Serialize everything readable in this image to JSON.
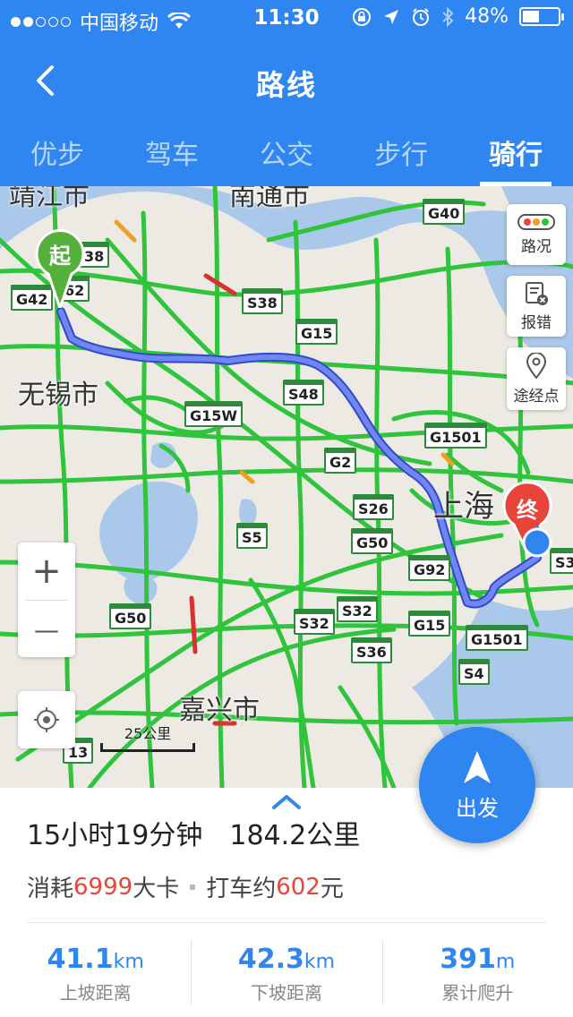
{
  "status_bar": {
    "carrier": "中国移动",
    "time": "11:30",
    "battery": "48%",
    "battery_level": 0.48
  },
  "nav": {
    "title": "路线"
  },
  "tabs": [
    {
      "label": "优步"
    },
    {
      "label": "驾车"
    },
    {
      "label": "公交"
    },
    {
      "label": "步行"
    },
    {
      "label": "骑行",
      "active": true
    }
  ],
  "map": {
    "cities": [
      "靖江市",
      "南通市",
      "无锡市",
      "上海",
      "嘉兴市"
    ],
    "highways": [
      "G40",
      "G42",
      "S38",
      "G15",
      "S48",
      "G15W",
      "G1501",
      "G2",
      "S26",
      "G50",
      "S5",
      "G92",
      "G50",
      "S32",
      "S32",
      "G15",
      "S36",
      "G1501",
      "S4",
      "S3",
      "38",
      "62",
      "13"
    ],
    "start_label": "起",
    "end_label": "终",
    "side_buttons": {
      "traffic": "路况",
      "report": "报错",
      "waypoint": "途经点"
    },
    "zoom_in": "+",
    "zoom_out": "—",
    "scale": "25公里"
  },
  "go_button": {
    "label": "出发"
  },
  "route": {
    "duration": "15小时19分钟",
    "distance": "184.2公里",
    "calories_prefix": "消耗",
    "calories_value": "6999",
    "calories_suffix": "大卡",
    "taxi_prefix": "打车约",
    "taxi_value": "602",
    "taxi_suffix": "元"
  },
  "stats": [
    {
      "value": "41.1",
      "unit": "km",
      "label": "上坡距离"
    },
    {
      "value": "42.3",
      "unit": "km",
      "label": "下坡距离"
    },
    {
      "value": "391",
      "unit": "m",
      "label": "累计爬升"
    }
  ],
  "colors": {
    "primary": "#2f86f0",
    "road": "#2fc43c",
    "route": "#5a6ee8",
    "accent_red": "#e8443a"
  }
}
